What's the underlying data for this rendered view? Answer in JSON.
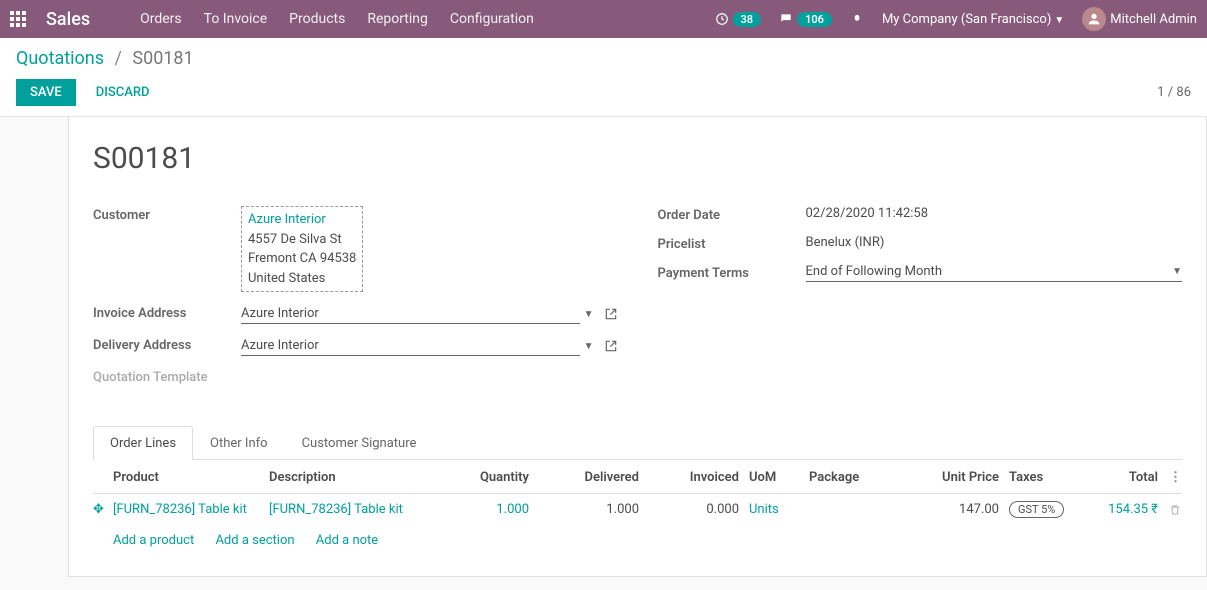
{
  "navbar": {
    "brand": "Sales",
    "menu": [
      "Orders",
      "To Invoice",
      "Products",
      "Reporting",
      "Configuration"
    ],
    "clock_badge": "38",
    "chat_badge": "106",
    "company": "My Company (San Francisco)",
    "user": "Mitchell Admin"
  },
  "breadcrumb": {
    "root": "Quotations",
    "current": "S00181"
  },
  "buttons": {
    "save": "SAVE",
    "discard": "DISCARD"
  },
  "pager": "1 / 86",
  "form": {
    "title": "S00181",
    "labels": {
      "customer": "Customer",
      "invoice_address": "Invoice Address",
      "delivery_address": "Delivery Address",
      "quotation_template": "Quotation Template",
      "order_date": "Order Date",
      "pricelist": "Pricelist",
      "payment_terms": "Payment Terms"
    },
    "customer": {
      "name": "Azure Interior",
      "street": "4557 De Silva St",
      "city_line": "Fremont CA 94538",
      "country": "United States"
    },
    "invoice_address": "Azure Interior",
    "delivery_address": "Azure Interior",
    "order_date": "02/28/2020 11:42:58",
    "pricelist": "Benelux (INR)",
    "payment_terms": "End of Following Month"
  },
  "tabs": [
    "Order Lines",
    "Other Info",
    "Customer Signature"
  ],
  "table": {
    "headers": {
      "product": "Product",
      "description": "Description",
      "quantity": "Quantity",
      "delivered": "Delivered",
      "invoiced": "Invoiced",
      "uom": "UoM",
      "package": "Package",
      "unit_price": "Unit Price",
      "taxes": "Taxes",
      "total": "Total"
    },
    "rows": [
      {
        "product": "[FURN_78236] Table kit",
        "description": "[FURN_78236] Table kit",
        "quantity": "1.000",
        "delivered": "1.000",
        "invoiced": "0.000",
        "uom": "Units",
        "package": "",
        "unit_price": "147.00",
        "taxes": "GST 5%",
        "total": "154.35 ₹"
      }
    ],
    "add_product": "Add a product",
    "add_section": "Add a section",
    "add_note": "Add a note"
  }
}
